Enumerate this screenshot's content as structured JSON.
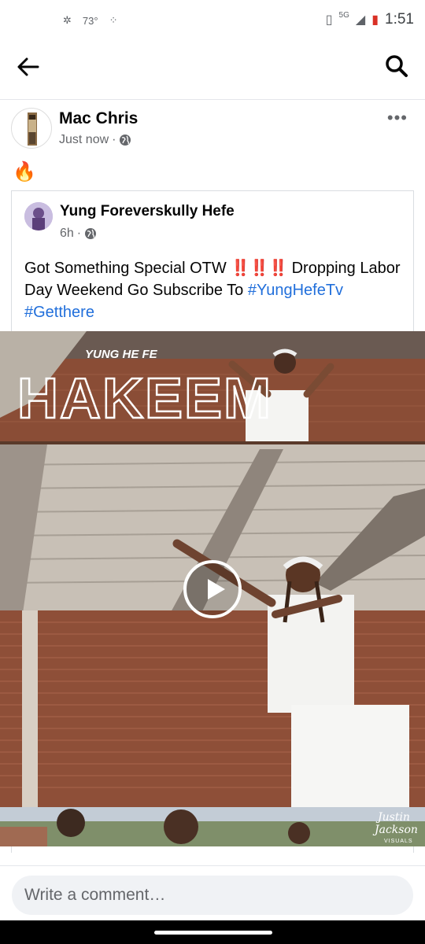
{
  "status_bar": {
    "temperature": "73°",
    "network": "5G",
    "time": "1:51"
  },
  "post": {
    "author": "Mac Chris",
    "timestamp": "Just now",
    "meta_separator": "·",
    "privacy_icon": "globe-icon",
    "text": "🔥"
  },
  "shared_post": {
    "author": "Yung Foreverskully Hefe",
    "timestamp": "6h",
    "meta_separator": "·",
    "privacy_icon": "globe-icon",
    "text_part1": "Got Something Special OTW ",
    "emphasis": "‼️‼️‼️",
    "text_part2": " Dropping Labor Day Weekend Go Subscribe To ",
    "hashtags": [
      "#YungHefeTv",
      "#Getthere"
    ]
  },
  "video": {
    "overlay_title_small": "YUNG HE FE",
    "overlay_title_large": "HAKEEM",
    "watermark_line1": "Justin",
    "watermark_line2": "Jackson",
    "watermark_line3": "VISUALS"
  },
  "comment": {
    "placeholder": "Write a comment…"
  },
  "colors": {
    "link": "#216fdb",
    "text": "#050505",
    "muted": "#65676b",
    "input_bg": "#f0f2f5"
  }
}
